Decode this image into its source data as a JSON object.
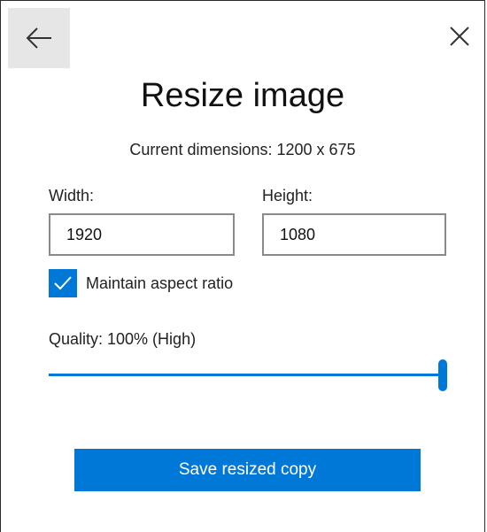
{
  "dialog": {
    "title": "Resize image",
    "current_dimensions": "Current dimensions: 1200 x 675"
  },
  "icons": {
    "back": "back-arrow-icon",
    "close": "close-icon",
    "check": "checkmark-icon"
  },
  "fields": {
    "width_label": "Width:",
    "width_value": "1920",
    "height_label": "Height:",
    "height_value": "1080"
  },
  "aspect": {
    "label": "Maintain aspect ratio",
    "checked": true
  },
  "quality": {
    "label": "Quality: 100% (High)",
    "value": 100,
    "min": 0,
    "max": 100
  },
  "actions": {
    "save_label": "Save resized copy"
  },
  "colors": {
    "accent": "#0078d7",
    "back_button_bg": "#e6e6e6"
  }
}
